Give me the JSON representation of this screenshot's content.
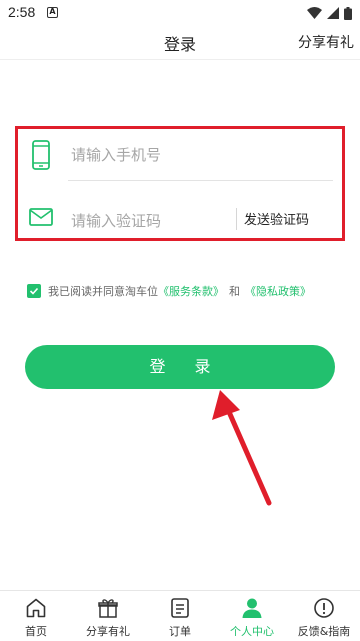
{
  "status_bar": {
    "time": "2:58",
    "app_icon_letter": "A"
  },
  "header": {
    "title": "登录",
    "share_label": "分享有礼"
  },
  "form": {
    "phone_placeholder": "请输入手机号",
    "code_placeholder": "请输入验证码",
    "send_code_label": "发送验证码"
  },
  "agreement": {
    "prefix": "我已阅读并同意淘车位",
    "terms_link": "《服务条款》",
    "conjunction": "和",
    "privacy_link": "《隐私政策》",
    "checked": true
  },
  "login_button": {
    "label": "登 录"
  },
  "tabs": [
    {
      "label": "首页",
      "icon": "home-icon",
      "active": false
    },
    {
      "label": "分享有礼",
      "icon": "gift-icon",
      "active": false
    },
    {
      "label": "订单",
      "icon": "order-icon",
      "active": false
    },
    {
      "label": "个人中心",
      "icon": "person-icon",
      "active": true
    },
    {
      "label": "反馈&指南",
      "icon": "info-icon",
      "active": false
    }
  ],
  "colors": {
    "accent": "#22c06e",
    "highlight": "#e01e2b"
  }
}
